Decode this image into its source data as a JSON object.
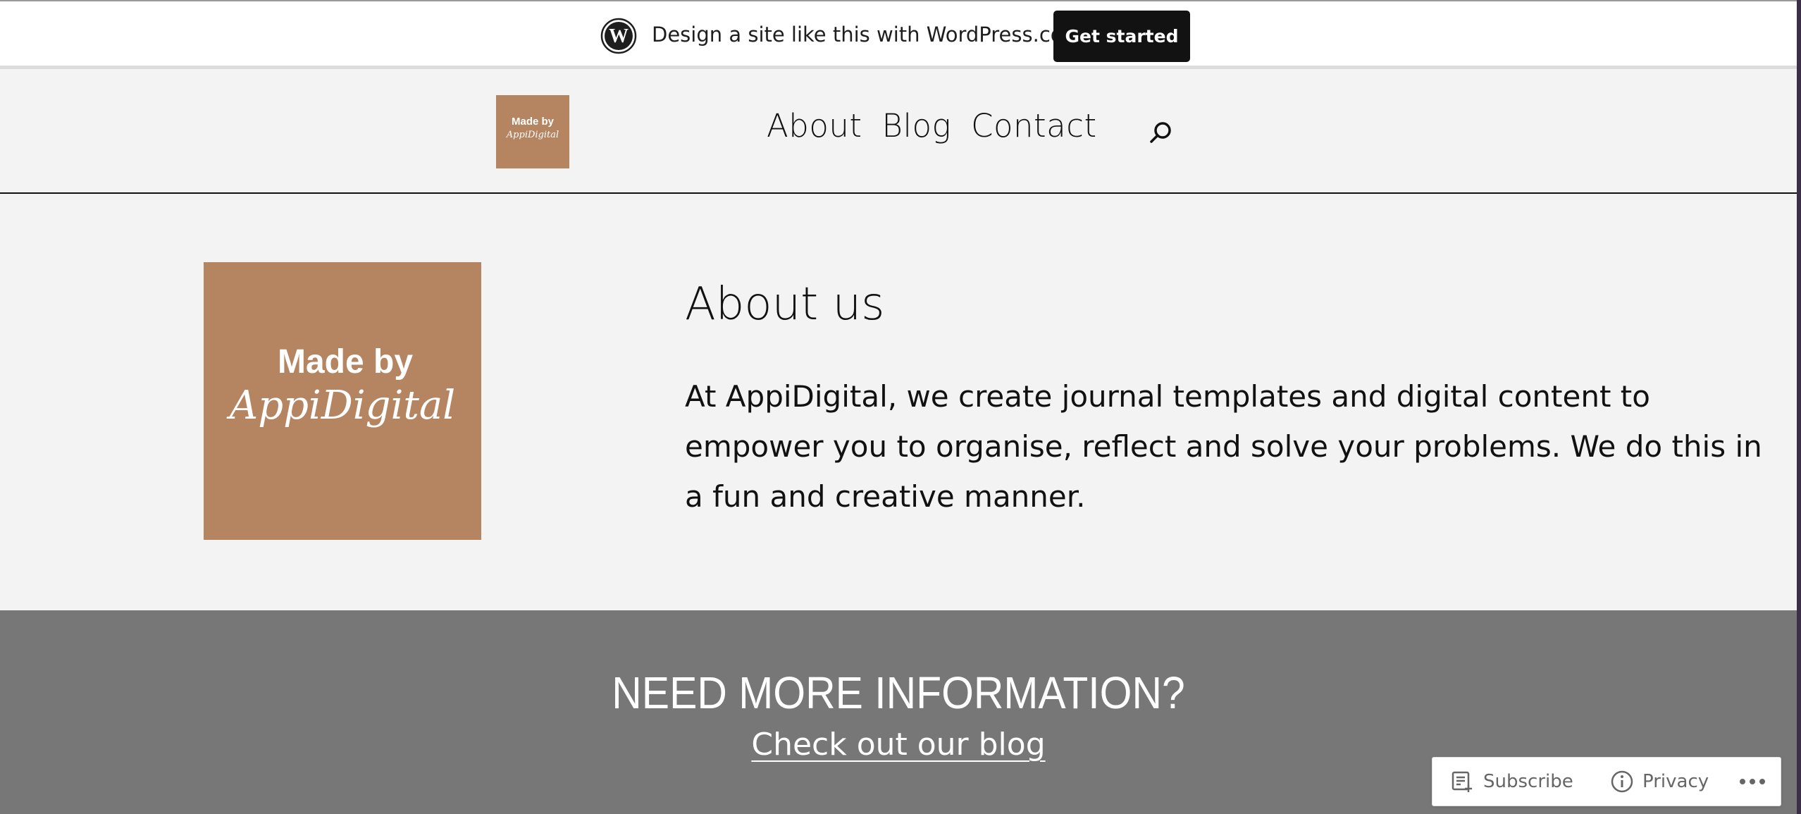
{
  "promo": {
    "text": "Design a site like this with WordPress.com",
    "cta_label": "Get started",
    "icon": "wordpress-logo-icon"
  },
  "header": {
    "logo": {
      "line1": "Made by",
      "line2": "AppiDigital",
      "bg": "#b58461"
    },
    "nav": [
      "About",
      "Blog",
      "Contact"
    ],
    "search_icon": "search-icon"
  },
  "about": {
    "image": {
      "line1": "Made by",
      "line2": "AppiDigital",
      "bg": "#b58461"
    },
    "title": "About us",
    "body": "At AppiDigital, we create journal templates and digital content to empower you to organise, reflect and solve your problems. We do this in a fun and creative manner."
  },
  "cta": {
    "heading": "NEED MORE INFORMATION?",
    "link": "Check out our blog",
    "bg": "#777777"
  },
  "actionbar": {
    "subscribe": "Subscribe",
    "privacy": "Privacy",
    "more_icon": "ellipsis-icon"
  }
}
